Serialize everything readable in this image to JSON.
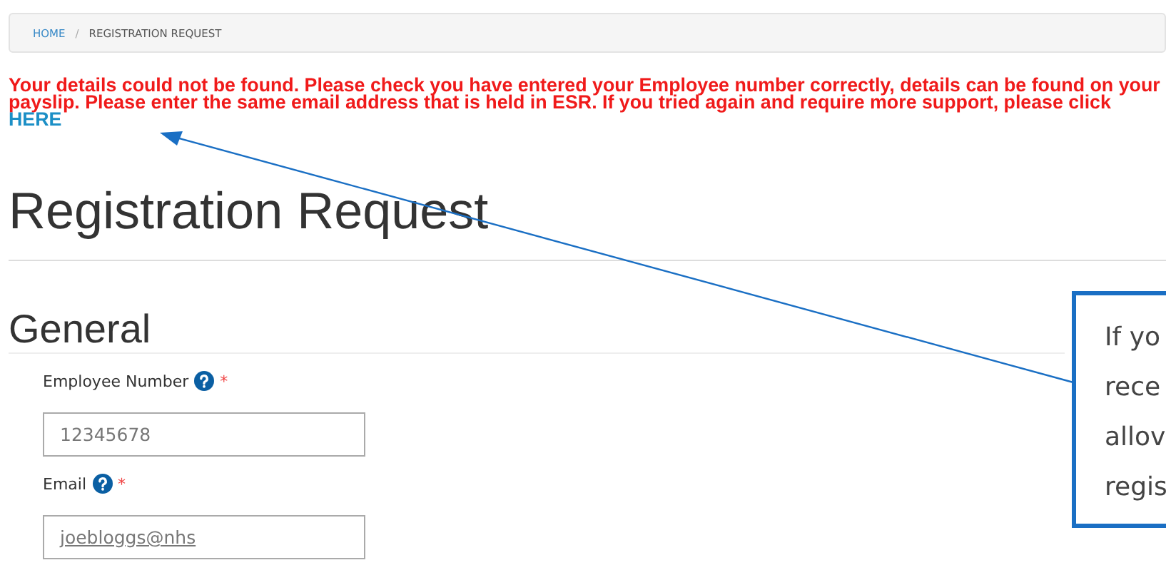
{
  "breadcrumb": [
    {
      "label": "HOME",
      "link": true
    },
    {
      "label": "REGISTRATION REQUEST",
      "link": false
    }
  ],
  "breadcrumb_separator": "/",
  "required_mark": "*",
  "error": {
    "message": "Your details could not be found. Please check you have entered your Employee number correctly, details can be found on your payslip. Please enter the same email address that is held in ESR. If you tried again and require more support, please click",
    "link": "HERE"
  },
  "title": "Registration Request",
  "section": "General",
  "fields": [
    {
      "label": "Employee Number",
      "required": true,
      "value": "12345678"
    },
    {
      "label": "Email",
      "required": true,
      "value": "joebloggs@nhs"
    }
  ],
  "callout": {
    "lines": [
      "If yo",
      "rece",
      "allov",
      "regis"
    ]
  }
}
